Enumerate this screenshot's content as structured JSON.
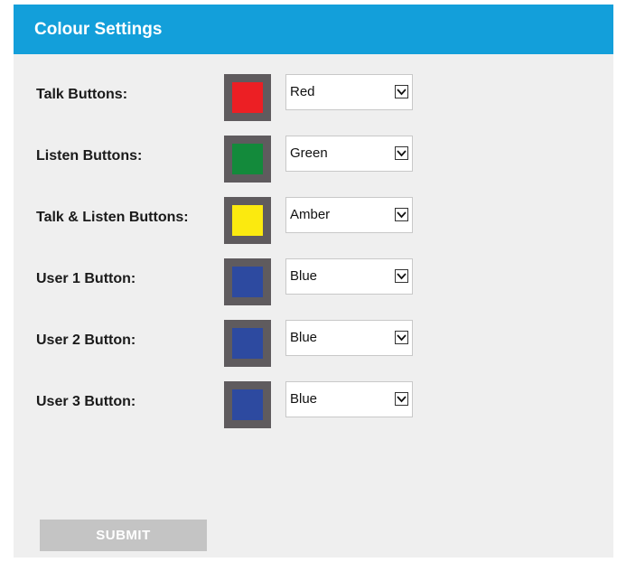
{
  "header": {
    "title": "Colour Settings"
  },
  "rows": [
    {
      "label": "Talk Buttons:",
      "value": "Red",
      "swatch_color": "#ec1f24"
    },
    {
      "label": "Listen Buttons:",
      "value": "Green",
      "swatch_color": "#138a3b"
    },
    {
      "label": "Talk & Listen Buttons:",
      "value": "Amber",
      "swatch_color": "#fbea0f"
    },
    {
      "label": "User 1 Button:",
      "value": "Blue",
      "swatch_color": "#2d4aa0"
    },
    {
      "label": "User 2 Button:",
      "value": "Blue",
      "swatch_color": "#2d4aa0"
    },
    {
      "label": "User 3 Button:",
      "value": "Blue",
      "swatch_color": "#2d4aa0"
    }
  ],
  "submit_label": "SUBMIT",
  "colors": {
    "header_bg": "#139fda",
    "panel_bg": "#efefef",
    "swatch_frame": "#5f5b5e",
    "submit_bg": "#c4c4c4"
  }
}
